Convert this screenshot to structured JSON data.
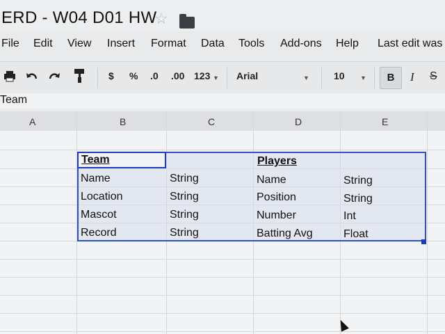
{
  "doc": {
    "title": "ERD - W04 D01 HW"
  },
  "menu": [
    "File",
    "Edit",
    "View",
    "Insert",
    "Format",
    "Data",
    "Tools",
    "Add-ons",
    "Help"
  ],
  "last_edit": "Last edit was",
  "toolbar": {
    "currency": "$",
    "percent": "%",
    "dec_less": ".0",
    "dec_more": ".00",
    "more_formats": "123",
    "font": "Arial",
    "font_size": "10",
    "bold": "B",
    "italic": "I",
    "strike": "S"
  },
  "formula": {
    "value": "Team"
  },
  "columns": [
    "A",
    "B",
    "C",
    "D",
    "E"
  ],
  "table": {
    "team_header": "Team",
    "players_header": "Players",
    "rows": [
      {
        "b": "Name",
        "c": "String",
        "d": "Name",
        "e": "String"
      },
      {
        "b": "Location",
        "c": "String",
        "d": "Position",
        "e": "String"
      },
      {
        "b": "Mascot",
        "c": "String",
        "d": "Number",
        "e": "Int"
      },
      {
        "b": "Record",
        "c": "String",
        "d": "Batting Avg",
        "e": "Float"
      }
    ]
  }
}
